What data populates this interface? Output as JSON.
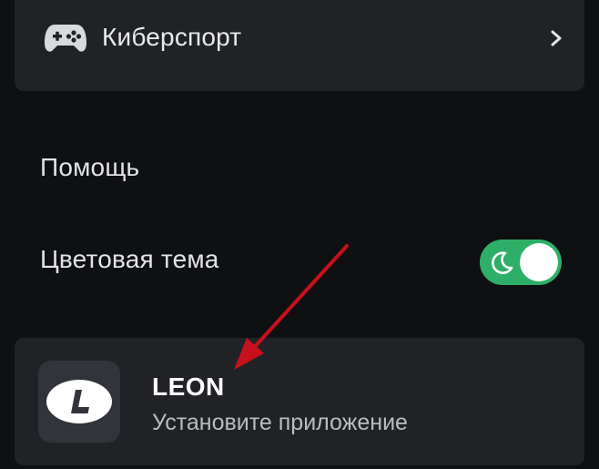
{
  "menu": {
    "esports": {
      "label": "Киберспорт",
      "icon": "gamepad-icon",
      "chevron": "chevron-right-icon"
    },
    "help": {
      "label": "Помощь"
    },
    "theme": {
      "label": "Цветовая тема",
      "toggle_state": "on",
      "toggle_icon": "moon-icon",
      "toggle_color": "#2eaf67"
    }
  },
  "app_banner": {
    "name": "LEON",
    "subtitle": "Установите приложение",
    "logo": "leon-logo"
  },
  "annotation": {
    "arrow_color": "#c8101c"
  }
}
